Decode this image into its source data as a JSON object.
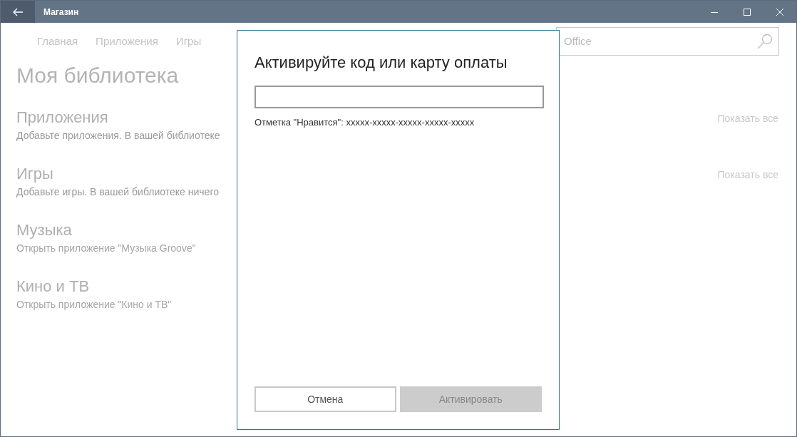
{
  "window": {
    "title": "Магазин"
  },
  "nav": [
    {
      "label": "Главная"
    },
    {
      "label": "Приложения"
    },
    {
      "label": "Игры"
    }
  ],
  "search": {
    "value": "Office"
  },
  "page_title": "Моя библиотека",
  "sections": [
    {
      "title": "Приложения",
      "subtitle": "Добавьте приложения. В вашей библиотеке",
      "link": "Показать все"
    },
    {
      "title": "Игры",
      "subtitle": "Добавьте игры. В вашей библиотеке ничего",
      "link": "Показать все"
    },
    {
      "title": "Музыка",
      "subtitle": "Открыть приложение \"Музыка Groove\""
    },
    {
      "title": "Кино и ТВ",
      "subtitle": "Открыть приложение \"Кино и ТВ\""
    }
  ],
  "dialog": {
    "title": "Активируйте код или карту оплаты",
    "hint": "Отметка \"Нравится\": xxxxx-xxxxx-xxxxx-xxxxx-xxxxx",
    "buttons": [
      {
        "label": "Отмена",
        "disabled": false
      },
      {
        "label": "Активировать",
        "disabled": true
      }
    ]
  }
}
